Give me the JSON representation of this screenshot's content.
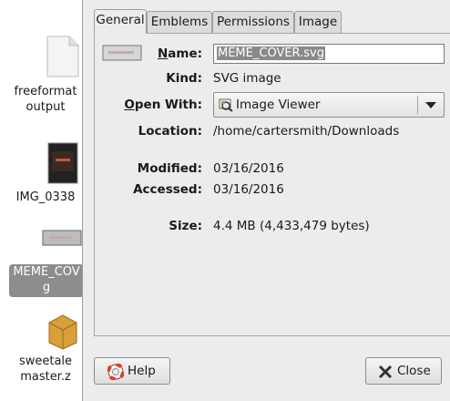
{
  "desktop": {
    "items": [
      {
        "label": "freeformat\noutput",
        "icon": "text-document-icon"
      },
      {
        "label": "IMG_0338",
        "icon": "image-thumbnail-icon"
      },
      {
        "label": "MEME_COV\ng",
        "icon": "svg-thumbnail-icon",
        "selected": true
      },
      {
        "label": "sweetale\nmaster.z",
        "icon": "archive-icon"
      }
    ]
  },
  "dialog": {
    "tabs": [
      "General",
      "Emblems",
      "Permissions",
      "Image"
    ],
    "active_tab": "General",
    "fields": {
      "name_label": "Name:",
      "name_value": "MEME_COVER.svg",
      "kind_label": "Kind:",
      "kind_value": "SVG image",
      "open_with_label": "Open With:",
      "open_with_value": "Image Viewer",
      "location_label": "Location:",
      "location_value": "/home/cartersmith/Downloads",
      "modified_label": "Modified:",
      "modified_value": "03/16/2016",
      "accessed_label": "Accessed:",
      "accessed_value": "03/16/2016",
      "size_label": "Size:",
      "size_value": "4.4 MB (4,433,479 bytes)"
    },
    "buttons": {
      "help": "Help",
      "close": "Close"
    }
  },
  "colors": {
    "dialog_bg": "#ececec",
    "selection_bg": "#8d8d8d",
    "help_icon": "#d9412b",
    "close_icon": "#333333"
  }
}
